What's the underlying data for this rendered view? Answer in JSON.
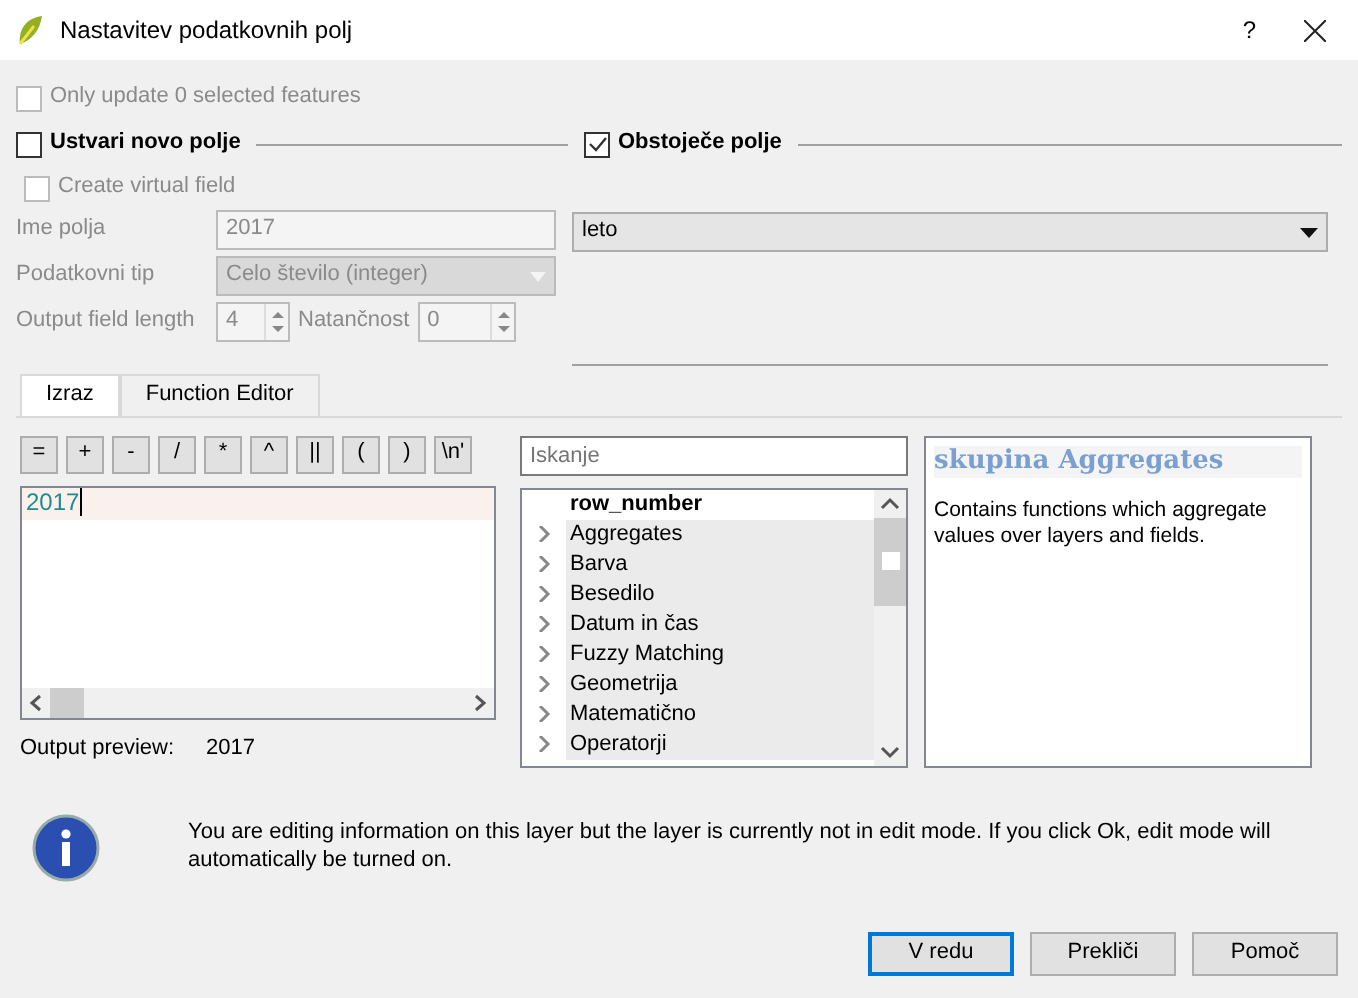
{
  "window": {
    "title": "Nastavitev podatkovnih polj",
    "help_button": "?"
  },
  "only_selected": {
    "label": "Only update 0 selected features",
    "checked": false,
    "disabled": true
  },
  "new_field_group": {
    "label": "Ustvari novo polje",
    "checked": false,
    "create_virtual": {
      "label": "Create virtual field",
      "checked": false
    },
    "name": {
      "label": "Ime polja",
      "value": "2017"
    },
    "type": {
      "label": "Podatkovni tip",
      "value": "Celo število (integer)"
    },
    "length": {
      "label": "Output field length",
      "value": "4"
    },
    "precision": {
      "label": "Natančnost",
      "value": "0"
    }
  },
  "existing_group": {
    "label": "Obstoječe polje",
    "checked": true,
    "field": "leto"
  },
  "tabs": [
    {
      "label": "Izraz",
      "selected": true
    },
    {
      "label": "Function Editor",
      "selected": false
    }
  ],
  "operators": [
    "=",
    "+",
    "-",
    "/",
    "*",
    "^",
    "||",
    "(",
    ")",
    "\\n'"
  ],
  "expression": "2017",
  "output_preview": {
    "label": "Output preview:",
    "value": "2017"
  },
  "search": {
    "placeholder": "Iskanje"
  },
  "function_tree": [
    {
      "label": "row_number",
      "kind": "function"
    },
    {
      "label": "Aggregates",
      "kind": "group",
      "expanded": false
    },
    {
      "label": "Barva",
      "kind": "group",
      "expanded": false
    },
    {
      "label": "Besedilo",
      "kind": "group",
      "expanded": false
    },
    {
      "label": "Datum in čas",
      "kind": "group",
      "expanded": false
    },
    {
      "label": "Fuzzy Matching",
      "kind": "group",
      "expanded": false
    },
    {
      "label": "Geometrija",
      "kind": "group",
      "expanded": false
    },
    {
      "label": "Matematično",
      "kind": "group",
      "expanded": false
    },
    {
      "label": "Operatorji",
      "kind": "group",
      "expanded": false
    }
  ],
  "help": {
    "title": "skupina Aggregates",
    "text": "Contains functions which aggregate values over layers and fields."
  },
  "message": "You are editing information on this layer but the layer is currently not in edit mode. If you click Ok, edit mode will automatically be turned on.",
  "buttons": [
    {
      "label": "V redu",
      "default": true
    },
    {
      "label": "Prekliči",
      "default": false
    },
    {
      "label": "Pomoč",
      "default": false
    }
  ]
}
